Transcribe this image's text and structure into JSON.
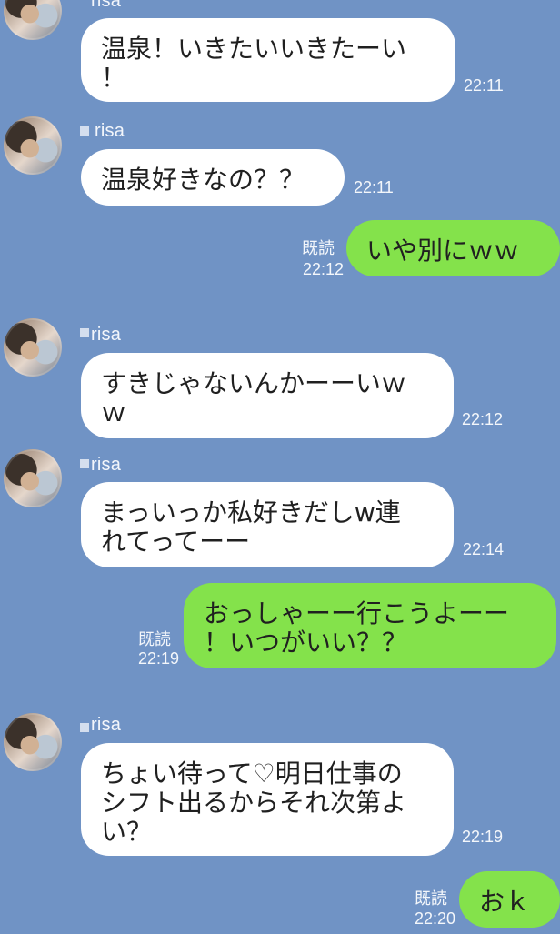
{
  "messages": [
    {
      "type": "incoming",
      "sender": "risa",
      "lines": [
        "温泉！いきたいいきたーい",
        "！"
      ],
      "time": "22:11"
    },
    {
      "type": "incoming",
      "sender": "risa",
      "lines": [
        "温泉好きなの？？"
      ],
      "time": "22:11"
    },
    {
      "type": "outgoing",
      "read": "既読",
      "lines": [
        "いや別にｗｗ"
      ],
      "time": "22:12"
    },
    {
      "type": "incoming",
      "sender": "risa",
      "lines": [
        "すきじゃないんかーーいｗ",
        "ｗ"
      ],
      "time": "22:12"
    },
    {
      "type": "incoming",
      "sender": "risa",
      "lines": [
        "まっいっか私好きだしw連",
        "れてってーー"
      ],
      "time": "22:14"
    },
    {
      "type": "outgoing",
      "read": "既読",
      "lines": [
        "おっしゃーー行こうよーー",
        "！いつがいい？？"
      ],
      "time": "22:19"
    },
    {
      "type": "incoming",
      "sender": "risa",
      "lines": [
        "ちょい待って♡明日仕事の",
        "シフト出るからそれ次第よ",
        "い？"
      ],
      "time": "22:19"
    },
    {
      "type": "outgoing",
      "read": "既読",
      "lines": [
        "おｋ"
      ],
      "time": "22:20"
    }
  ]
}
